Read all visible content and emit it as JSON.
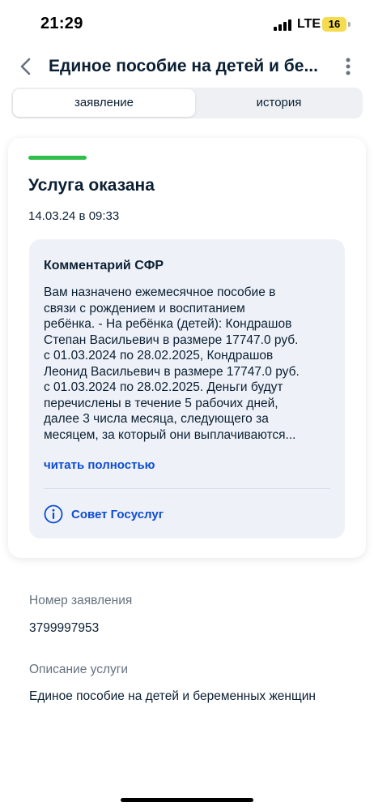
{
  "status_bar": {
    "time": "21:29",
    "network": "LTE",
    "battery": "16",
    "battery_color": "#f5dc4e"
  },
  "header": {
    "title": "Единое пособие на детей и бе...",
    "back_icon": "chevron-left-icon",
    "more_icon": "vertical-dots-icon"
  },
  "tabs": [
    {
      "label": "заявление",
      "active": true
    },
    {
      "label": "история",
      "active": false
    }
  ],
  "status_card": {
    "status": "Услуга оказана",
    "status_color": "#2fbf4a",
    "datetime": "14.03.24 в 09:33"
  },
  "comment": {
    "title": "Комментарий СФР",
    "lines": [
      "Вам назначено ежемесячное пособие в",
      "связи с рождением и воспитанием",
      "ребёнка. - На ребёнка (детей): Кондрашов",
      "Степан Васильевич в размере 17747.0 руб.",
      "с 01.03.2024 по 28.02.2025, Кондрашов",
      "Леонид Васильевич в размере 17747.0 руб.",
      "с 01.03.2024 по 28.02.2025. Деньги будут",
      "перечислены в течение 5 рабочих дней,",
      "далее 3 числа месяца, следующего за",
      "месяцем, за который они выплачиваются..."
    ],
    "read_more": "читать полностью",
    "advice_label": "Совет Госуслуг",
    "advice_icon": "info-circle-icon",
    "link_color": "#0d4cd3"
  },
  "details": {
    "number_label": "Номер заявления",
    "number_value": "3799997953",
    "description_label": "Описание услуги",
    "description_value": "Единое пособие на детей и беременных женщин"
  }
}
